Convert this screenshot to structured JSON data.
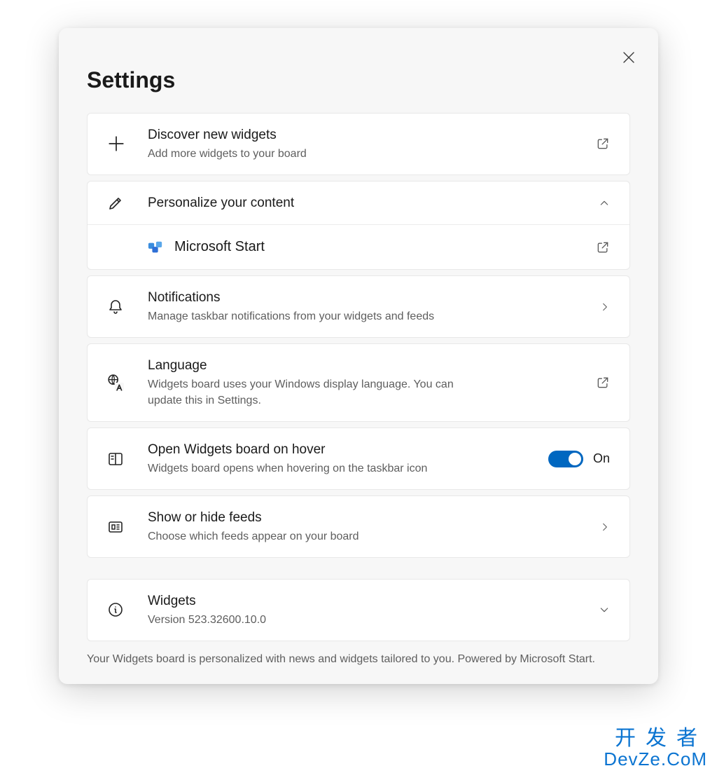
{
  "header": {
    "title": "Settings"
  },
  "rows": {
    "discover": {
      "title": "Discover new widgets",
      "subtitle": "Add more widgets to your board"
    },
    "personalize": {
      "title": "Personalize your content",
      "child_label": "Microsoft Start"
    },
    "notifications": {
      "title": "Notifications",
      "subtitle": "Manage taskbar notifications from your widgets and feeds"
    },
    "language": {
      "title": "Language",
      "subtitle": "Widgets board uses your Windows display language. You can update this in Settings."
    },
    "hover": {
      "title": "Open Widgets board on hover",
      "subtitle": "Widgets board opens when hovering on the taskbar icon",
      "toggle_state": "On",
      "toggle_on": true
    },
    "feeds": {
      "title": "Show or hide feeds",
      "subtitle": "Choose which feeds appear on your board"
    },
    "about": {
      "title": "Widgets",
      "subtitle": "Version 523.32600.10.0"
    }
  },
  "footer_note": "Your Widgets board is personalized with news and widgets tailored to you. Powered by Microsoft Start.",
  "watermark": {
    "line1": "开发者",
    "line2": "DevZe.CoM"
  }
}
